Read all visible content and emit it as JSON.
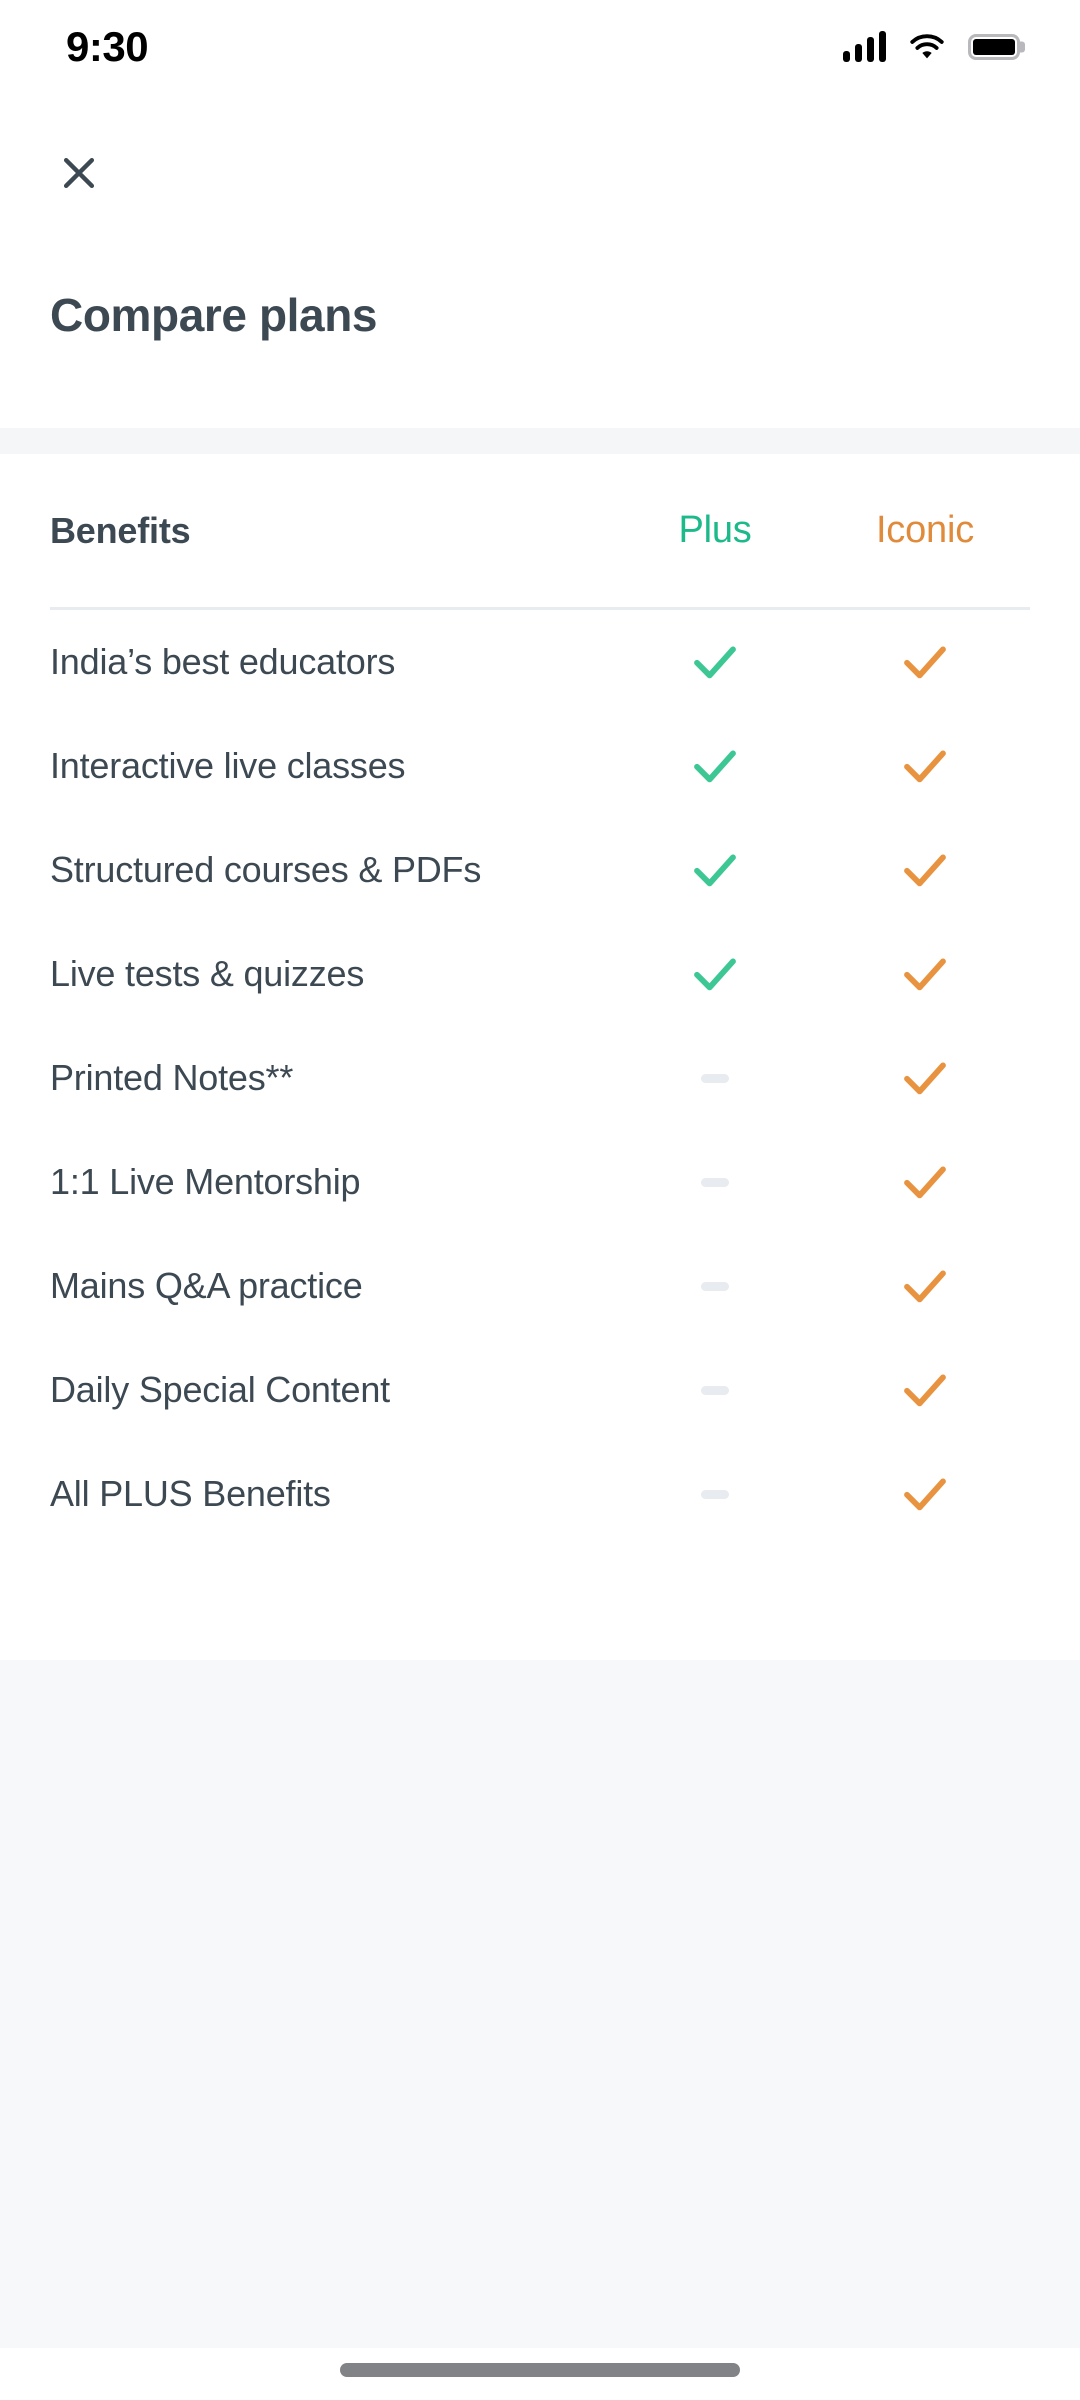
{
  "status_bar": {
    "time": "9:30",
    "icons": [
      "signal-icon",
      "wifi-icon",
      "battery-icon"
    ]
  },
  "header": {
    "close_icon": "close-icon",
    "title": "Compare plans"
  },
  "colors": {
    "plus": "#1CB98A",
    "iconic": "#E08B3C",
    "tick_plus": "#3DC795",
    "tick_iconic": "#E89340",
    "text": "#3C4852",
    "divider": "#E9ECEF",
    "dash": "#E8EBEF",
    "page_bg": "#F6F8F9"
  },
  "table": {
    "columns": [
      {
        "label": "Benefits",
        "key": "benefit"
      },
      {
        "label": "Plus",
        "key": "plus"
      },
      {
        "label": "Iconic",
        "key": "iconic"
      }
    ],
    "rows": [
      {
        "benefit": "India’s best educators",
        "plus": "check",
        "iconic": "check"
      },
      {
        "benefit": "Interactive live classes",
        "plus": "check",
        "iconic": "check"
      },
      {
        "benefit": "Structured courses & PDFs",
        "plus": "check",
        "iconic": "check"
      },
      {
        "benefit": "Live tests & quizzes",
        "plus": "check",
        "iconic": "check"
      },
      {
        "benefit": "Printed Notes**",
        "plus": "dash",
        "iconic": "check"
      },
      {
        "benefit": "1:1 Live Mentorship",
        "plus": "dash",
        "iconic": "check"
      },
      {
        "benefit": "Mains Q&A practice",
        "plus": "dash",
        "iconic": "check"
      },
      {
        "benefit": "Daily Special Content",
        "plus": "dash",
        "iconic": "check"
      },
      {
        "benefit": "All PLUS Benefits",
        "plus": "dash",
        "iconic": "check"
      }
    ]
  },
  "home_indicator": "home-indicator"
}
